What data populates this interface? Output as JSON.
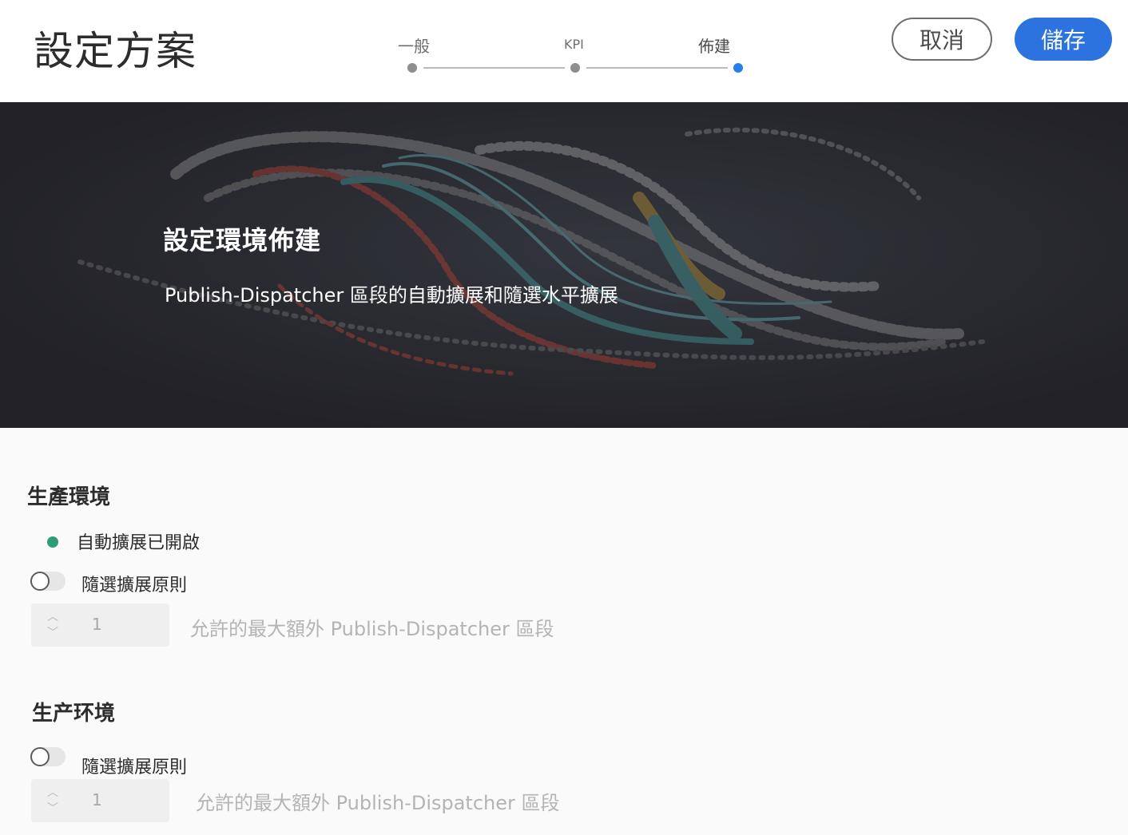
{
  "header": {
    "title": "設定方案",
    "steps": [
      {
        "label": "一般",
        "state": "done"
      },
      {
        "label": "KPI",
        "state": "done"
      },
      {
        "label": "佈建",
        "state": "current"
      }
    ],
    "cancel_label": "取消",
    "save_label": "儲存"
  },
  "hero": {
    "title": "設定環境佈建",
    "subtitle": "Publish-Dispatcher 區段的自動擴展和隨選水平擴展"
  },
  "sections": [
    {
      "title": "生產環境",
      "status_text": "自動擴展已開啟",
      "toggle_label": "隨選擴展原則",
      "toggle_on": false,
      "stepper_value": "1",
      "stepper_hint": "允許的最大額外 Publish-Dispatcher 區段"
    },
    {
      "title": "生产环境",
      "toggle_label": "隨選擴展原則",
      "toggle_on": false,
      "stepper_value": "1",
      "stepper_hint": "允許的最大額外 Publish-Dispatcher 區段"
    }
  ],
  "colors": {
    "accent": "#2d73e0",
    "step_active": "#2680eb",
    "status_green": "#2d9d78"
  }
}
